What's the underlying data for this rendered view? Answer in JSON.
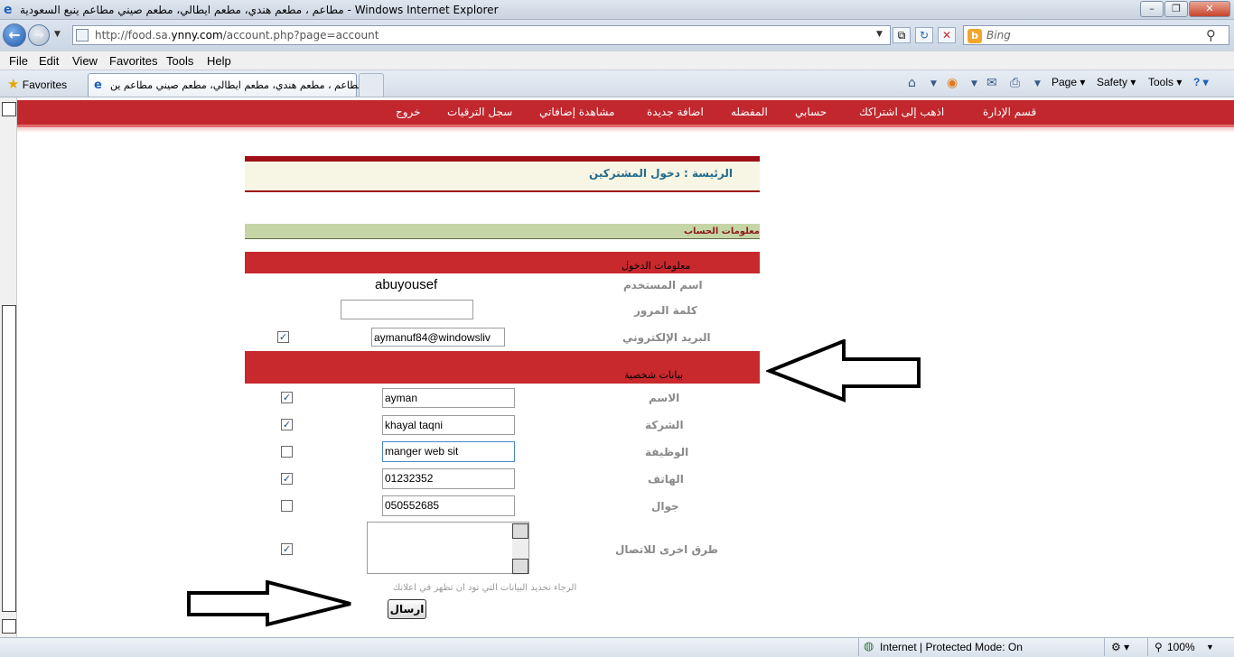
{
  "window": {
    "title": "مطاعم ، مطعم هندي، مطعم ايطالي، مطعم صيني مطاعم ينبع السعودية - Windows Internet Explorer",
    "minimize": "–",
    "restore": "❐",
    "close": "✕"
  },
  "address": {
    "url_prefix": "http://food.sa.",
    "url_domain": "ynny.com",
    "url_suffix": "/account.php?page=account",
    "search_placeholder": "Bing"
  },
  "menu": [
    "File",
    "Edit",
    "View",
    "Favorites",
    "Tools",
    "Help"
  ],
  "favorites_label": "Favorites",
  "tab": {
    "label": "مطاعم ، مطعم هندي، مطعم ايطالي، مطعم صيني مطاعم ين..."
  },
  "commands": {
    "page": "Page ▾",
    "safety": "Safety ▾",
    "tools": "Tools ▾",
    "help": "? ▾"
  },
  "site_nav": [
    "قسم الإدارة",
    "اذهب إلى اشتراكك",
    "حسابي",
    "المفضله",
    "اضافة جديدة",
    "مشاهدة إضافاتي",
    "سجل الترقيات",
    "خروج"
  ],
  "breadcrumb": "الرئيسة  :  دخول المشتركين",
  "account_header": "معلومات الحساب",
  "login_section": "معلومات الدخول",
  "personal_section": "بيانات شخصية",
  "fields": {
    "username_label": "اسم المستخدم",
    "username_value": "abuyousef",
    "password_label": "كلمة المرور",
    "email_label": "البريد الإلكتروني",
    "email_value": "aymanuf84@windowsliv",
    "name_label": "الاسم",
    "name_value": "ayman",
    "company_label": "الشركة",
    "company_value": "khayal taqni",
    "job_label": "الوظيفة",
    "job_value": "manger web sit",
    "phone_label": "الهاتف",
    "phone_value": "01232352",
    "mobile_label": "جوال",
    "mobile_value": "050552685",
    "other_label": "طرق اخرى للاتصال"
  },
  "checkboxes": {
    "email": true,
    "name": true,
    "company": true,
    "job": false,
    "phone": true,
    "mobile": false,
    "other": true
  },
  "hint": "الرجاء تحديد البيانات التي تود ان تظهر في اعلانك",
  "submit": "ارسال",
  "status": {
    "zone": "Internet | Protected Mode: On",
    "zoom": "100%"
  }
}
